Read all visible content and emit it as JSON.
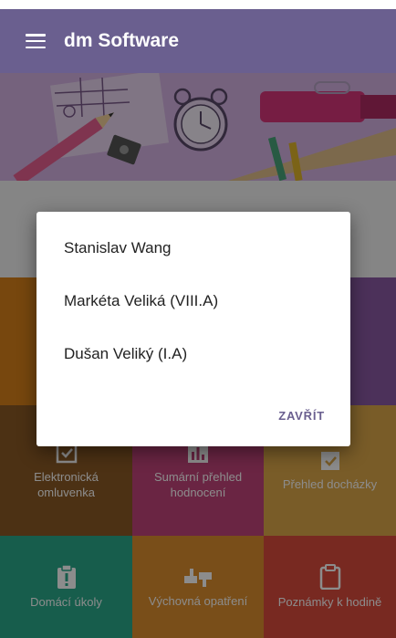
{
  "app": {
    "title": "dm Software"
  },
  "dialog": {
    "items": [
      {
        "label": "Stanislav Wang"
      },
      {
        "label": "Markéta Veliká (VIII.A)"
      },
      {
        "label": "Dušan Veliký (I.A)"
      }
    ],
    "close_label": "ZAVŘÍT"
  },
  "tiles": [
    {
      "label": "",
      "icon": "none",
      "color": "#d9821a"
    },
    {
      "label": "",
      "icon": "none",
      "color": "#c04a4a"
    },
    {
      "label": "",
      "icon": "none",
      "color": "#8a5aa5"
    },
    {
      "label": "Elektronická omluvenka",
      "icon": "checkbox-document-icon",
      "color": "#8b5a26"
    },
    {
      "label": "Sumární přehled hodnocení",
      "icon": "bar-chart-icon",
      "color": "#c2447a"
    },
    {
      "label": "Přehled docházky",
      "icon": "checklist-icon",
      "color": "#dda84a"
    },
    {
      "label": "Domácí úkoly",
      "icon": "clipboard-alert-icon",
      "color": "#2aa98a"
    },
    {
      "label": "Výchovná opatření",
      "icon": "thumbs-icon",
      "color": "#dd8e2e"
    },
    {
      "label": "Poznámky k hodině",
      "icon": "clipboard-icon",
      "color": "#db4b3d"
    }
  ],
  "colors": {
    "appbar": "#6a5f8f",
    "accent": "#6a5f8f",
    "banner": "#d6b3e4"
  }
}
